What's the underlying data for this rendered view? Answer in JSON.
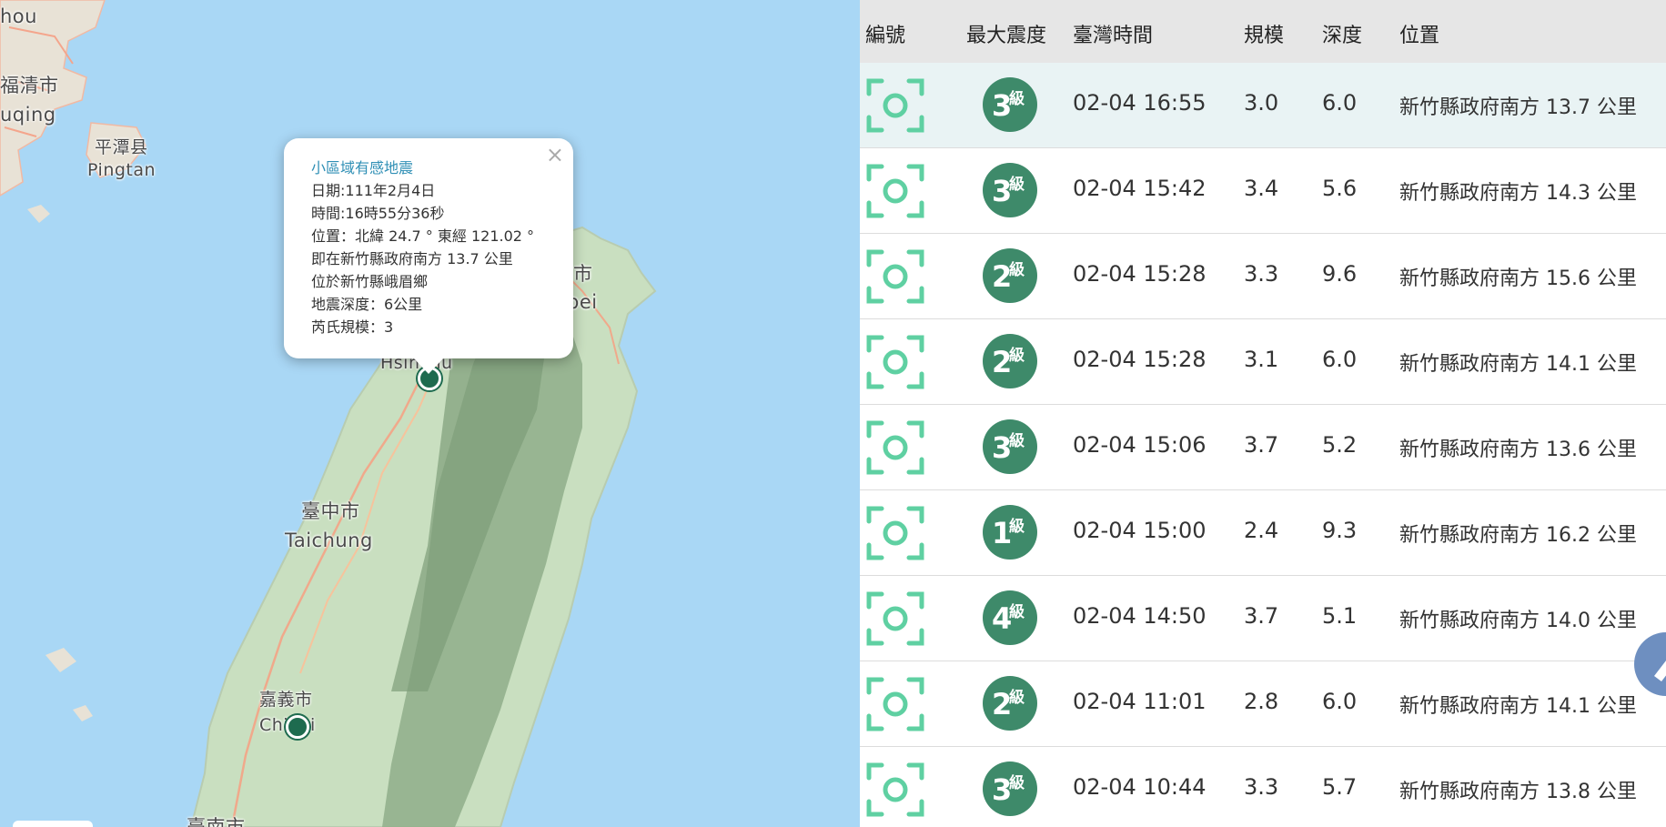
{
  "map": {
    "labels": [
      {
        "text": "hou"
      },
      {
        "text": "福清市"
      },
      {
        "text": "uqing"
      },
      {
        "text": "平潭县"
      },
      {
        "text": "Pingtan"
      },
      {
        "text": "市"
      },
      {
        "text": "pei"
      },
      {
        "text": "Hsinchu"
      },
      {
        "text": "臺中市"
      },
      {
        "text": "Taichung"
      },
      {
        "text": "嘉義市"
      },
      {
        "text": "Chiayi"
      },
      {
        "text": "臺南市"
      }
    ],
    "popup": {
      "title": "小區域有感地震",
      "date": "日期:111年2月4日",
      "time": "時間:16時55分36秒",
      "position": "位置：北緯 24.7 ° 東經 121.02 °",
      "relative": "即在新竹縣政府南方 13.7 公里",
      "located": "位於新竹縣峨眉鄉",
      "depth": "地震深度：6公里",
      "magnitude": "芮氏規模：3",
      "close": "×"
    }
  },
  "table": {
    "headers": {
      "id": "編號",
      "intensity": "最大震度",
      "time": "臺灣時間",
      "magnitude": "規模",
      "depth": "深度",
      "location": "位置"
    },
    "intensity_unit": "級",
    "rows": [
      {
        "intensity": "3",
        "time": "02-04 16:55",
        "magnitude": "3.0",
        "depth": "6.0",
        "location": "新竹縣政府南方 13.7 公里"
      },
      {
        "intensity": "3",
        "time": "02-04 15:42",
        "magnitude": "3.4",
        "depth": "5.6",
        "location": "新竹縣政府南方 14.3 公里"
      },
      {
        "intensity": "2",
        "time": "02-04 15:28",
        "magnitude": "3.3",
        "depth": "9.6",
        "location": "新竹縣政府南方 15.6 公里"
      },
      {
        "intensity": "2",
        "time": "02-04 15:28",
        "magnitude": "3.1",
        "depth": "6.0",
        "location": "新竹縣政府南方 14.1 公里"
      },
      {
        "intensity": "3",
        "time": "02-04 15:06",
        "magnitude": "3.7",
        "depth": "5.2",
        "location": "新竹縣政府南方 13.6 公里"
      },
      {
        "intensity": "1",
        "time": "02-04 15:00",
        "magnitude": "2.4",
        "depth": "9.3",
        "location": "新竹縣政府南方 16.2 公里"
      },
      {
        "intensity": "4",
        "time": "02-04 14:50",
        "magnitude": "3.7",
        "depth": "5.1",
        "location": "新竹縣政府南方 14.0 公里"
      },
      {
        "intensity": "2",
        "time": "02-04 11:01",
        "magnitude": "2.8",
        "depth": "6.0",
        "location": "新竹縣政府南方 14.1 公里"
      },
      {
        "intensity": "3",
        "time": "02-04 10:44",
        "magnitude": "3.3",
        "depth": "5.7",
        "location": "新竹縣政府南方 13.8 公里"
      }
    ]
  },
  "colors": {
    "sea": "#a9d7f5",
    "land": "#c9dfc0",
    "mountain": "#8fae8a",
    "badge": "#3e8a6a",
    "scan_icon": "#5fd0a2",
    "popup_title": "#2f8fb5"
  }
}
